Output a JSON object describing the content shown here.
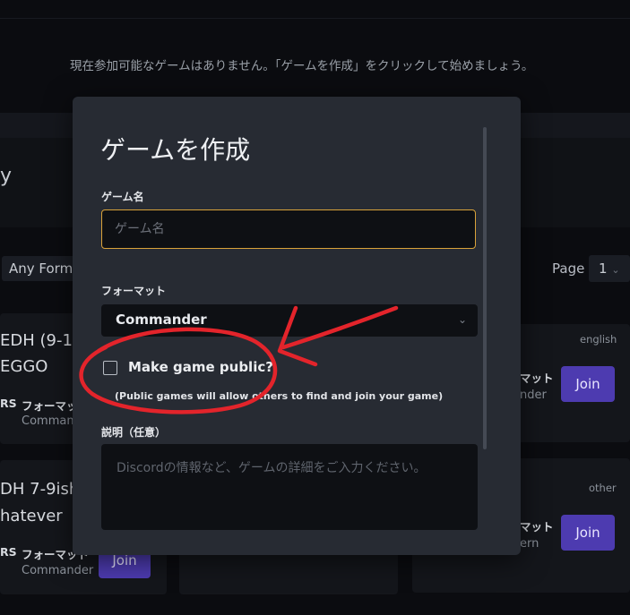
{
  "background": {
    "message": "現在参加可能なゲームはありません。「ゲームを作成」をクリックして始めましょう。",
    "title_fragment": "y",
    "format_filter": "Any Forma",
    "page_label": "Page",
    "page_value": "1",
    "cards": [
      {
        "title_line1": "EDH (9-10",
        "title_line2": "EGGO",
        "tag": "RS",
        "format_label": "フォーマット",
        "format_value": "Commander"
      },
      {
        "title_line1": "DH 7-9ish",
        "title_line2": "hatever",
        "tag": "RS",
        "format_label": "フォーマット",
        "format_value": "Commander",
        "join": "Join"
      },
      {
        "lang": "english",
        "format_label": "マット",
        "format_value": "nder",
        "join": "Join"
      },
      {
        "lang": "other",
        "format_label": "マット",
        "format_value": "ern",
        "join": "Join"
      }
    ]
  },
  "modal": {
    "title": "ゲームを作成",
    "name_label": "ゲーム名",
    "name_placeholder": "ゲーム名",
    "format_label": "フォーマット",
    "format_value": "Commander",
    "public_label": "Make game public?",
    "public_help": "(Public games will allow others to find and join your game)",
    "description_label": "説明（任意）",
    "description_placeholder": "Discordの情報など、ゲームの詳細をご入力ください。"
  },
  "colors": {
    "annotation": "#e3242b",
    "join_button": "#4d3bb0",
    "focus_border": "#d9a23a"
  }
}
